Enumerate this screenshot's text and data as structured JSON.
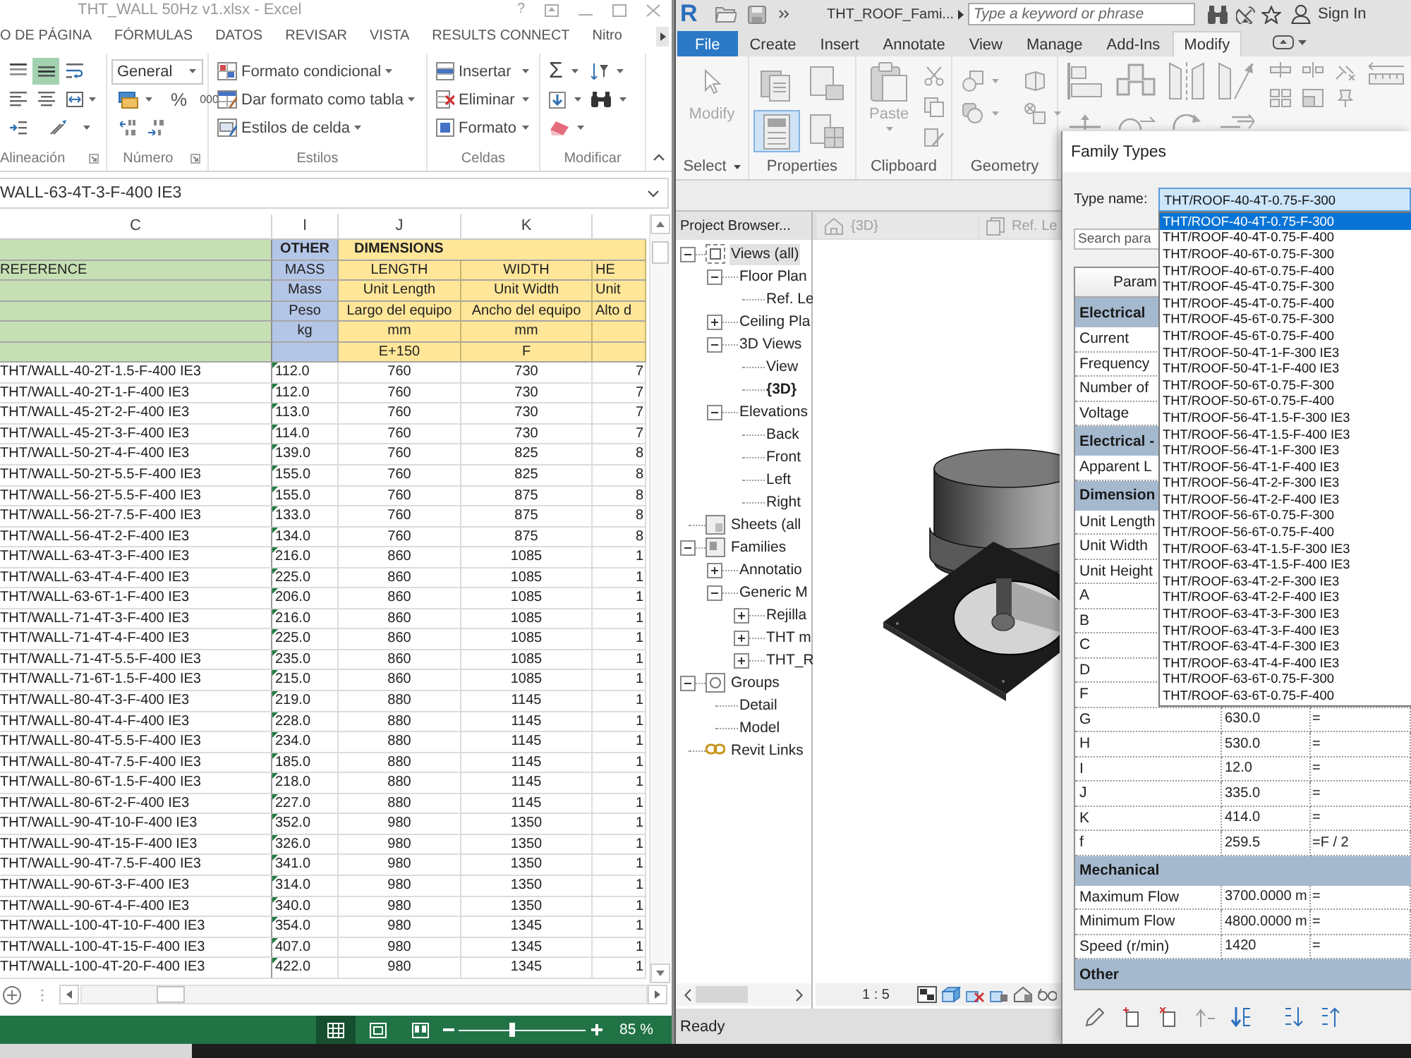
{
  "excel": {
    "title": "THT_WALL 50Hz v1.xlsx - Excel",
    "help": "?",
    "tabs": [
      {
        "label": "O DE PÁGINA",
        "selected": false
      },
      {
        "label": "FÓRMULAS",
        "selected": false
      },
      {
        "label": "DATOS",
        "selected": false
      },
      {
        "label": "REVISAR",
        "selected": false
      },
      {
        "label": "VISTA",
        "selected": false
      },
      {
        "label": "RESULTS CONNECT",
        "selected": false
      },
      {
        "label": "Nitro",
        "selected": false
      }
    ],
    "ribbon": {
      "alignment": {
        "label": "Alineación",
        "buttons": [
          {
            "selected": false
          },
          {
            "selected": true
          },
          {
            "selected": false
          },
          {
            "selected": false
          },
          {
            "selected": false
          },
          {
            "selected": false
          },
          {
            "selected": false
          },
          {
            "selected": false
          }
        ]
      },
      "number": {
        "label": "Número",
        "format": "General",
        "symbols": [
          "%",
          "000"
        ]
      },
      "styles": {
        "label": "Estilos",
        "commands": [
          "Formato condicional",
          "Dar formato como tabla",
          "Estilos de celda"
        ]
      },
      "cells": {
        "label": "Celdas",
        "commands": [
          "Insertar",
          "Eliminar",
          "Formato"
        ]
      },
      "editing": {
        "label": "Modificar",
        "autosum": "Σ"
      }
    },
    "formula_bar": {
      "value": "WALL-63-4T-3-F-400 IE3"
    },
    "sheet": {
      "columns": [
        "C",
        "I",
        "J",
        "K"
      ],
      "header_rows": [
        {
          "I": "OTHER",
          "J": "DIMENSIONS"
        },
        {
          "C": "REFERENCE",
          "I": "MASS",
          "J": "LENGTH",
          "K": "WIDTH",
          "column_5": "HE"
        },
        {
          "I": "Mass",
          "J": "Unit Length",
          "K": "Unit Width",
          "column_5": "Unit"
        },
        {
          "I": "Peso",
          "J": "Largo del equipo",
          "K": "Ancho del equipo",
          "column_5": "Alto d"
        },
        {
          "I": "kg",
          "J": "mm",
          "K": "mm"
        },
        {
          "J": "E+150",
          "K": "F"
        }
      ],
      "rows": [
        {
          "C": "THT/WALL-40-2T-1.5-F-400 IE3",
          "I": "112.0",
          "J": "760",
          "K": "730",
          "column_5": "7",
          "flag": true
        },
        {
          "C": "THT/WALL-40-2T-1-F-400 IE3",
          "I": "112.0",
          "J": "760",
          "K": "730",
          "column_5": "7",
          "flag": true
        },
        {
          "C": "THT/WALL-45-2T-2-F-400 IE3",
          "I": "113.0",
          "J": "760",
          "K": "730",
          "column_5": "7",
          "flag": true
        },
        {
          "C": "THT/WALL-45-2T-3-F-400 IE3",
          "I": "114.0",
          "J": "760",
          "K": "730",
          "column_5": "7",
          "flag": true
        },
        {
          "C": "THT/WALL-50-2T-4-F-400 IE3",
          "I": "139.0",
          "J": "760",
          "K": "825",
          "column_5": "8",
          "flag": true
        },
        {
          "C": "THT/WALL-50-2T-5.5-F-400 IE3",
          "I": "155.0",
          "J": "760",
          "K": "825",
          "column_5": "8",
          "flag": true
        },
        {
          "C": "THT/WALL-56-2T-5.5-F-400 IE3",
          "I": "155.0",
          "J": "760",
          "K": "875",
          "column_5": "8",
          "flag": true
        },
        {
          "C": "THT/WALL-56-2T-7.5-F-400 IE3",
          "I": "133.0",
          "J": "760",
          "K": "875",
          "column_5": "8",
          "flag": true
        },
        {
          "C": "THT/WALL-56-4T-2-F-400 IE3",
          "I": "134.0",
          "J": "760",
          "K": "875",
          "column_5": "8",
          "flag": true
        },
        {
          "C": "THT/WALL-63-4T-3-F-400 IE3",
          "I": "216.0",
          "J": "860",
          "K": "1085",
          "column_5": "1",
          "flag": true
        },
        {
          "C": "THT/WALL-63-4T-4-F-400 IE3",
          "I": "225.0",
          "J": "860",
          "K": "1085",
          "column_5": "1",
          "flag": true
        },
        {
          "C": "THT/WALL-63-6T-1-F-400 IE3",
          "I": "206.0",
          "J": "860",
          "K": "1085",
          "column_5": "1",
          "flag": true
        },
        {
          "C": "THT/WALL-71-4T-3-F-400 IE3",
          "I": "216.0",
          "J": "860",
          "K": "1085",
          "column_5": "1",
          "flag": true
        },
        {
          "C": "THT/WALL-71-4T-4-F-400 IE3",
          "I": "225.0",
          "J": "860",
          "K": "1085",
          "column_5": "1",
          "flag": true
        },
        {
          "C": "THT/WALL-71-4T-5.5-F-400 IE3",
          "I": "235.0",
          "J": "860",
          "K": "1085",
          "column_5": "1",
          "flag": true
        },
        {
          "C": "THT/WALL-71-6T-1.5-F-400 IE3",
          "I": "215.0",
          "J": "860",
          "K": "1085",
          "column_5": "1",
          "flag": true
        },
        {
          "C": "THT/WALL-80-4T-3-F-400 IE3",
          "I": "219.0",
          "J": "880",
          "K": "1145",
          "column_5": "1",
          "flag": true
        },
        {
          "C": "THT/WALL-80-4T-4-F-400 IE3",
          "I": "228.0",
          "J": "880",
          "K": "1145",
          "column_5": "1",
          "flag": true
        },
        {
          "C": "THT/WALL-80-4T-5.5-F-400 IE3",
          "I": "234.0",
          "J": "880",
          "K": "1145",
          "column_5": "1",
          "flag": true
        },
        {
          "C": "THT/WALL-80-4T-7.5-F-400 IE3",
          "I": "185.0",
          "J": "880",
          "K": "1145",
          "column_5": "1",
          "flag": true
        },
        {
          "C": "THT/WALL-80-6T-1.5-F-400 IE3",
          "I": "218.0",
          "J": "880",
          "K": "1145",
          "column_5": "1",
          "flag": true
        },
        {
          "C": "THT/WALL-80-6T-2-F-400 IE3",
          "I": "227.0",
          "J": "880",
          "K": "1145",
          "column_5": "1",
          "flag": true
        },
        {
          "C": "THT/WALL-90-4T-10-F-400 IE3",
          "I": "352.0",
          "J": "980",
          "K": "1350",
          "column_5": "1",
          "flag": true
        },
        {
          "C": "THT/WALL-90-4T-15-F-400 IE3",
          "I": "326.0",
          "J": "980",
          "K": "1350",
          "column_5": "1",
          "flag": true
        },
        {
          "C": "THT/WALL-90-4T-7.5-F-400 IE3",
          "I": "341.0",
          "J": "980",
          "K": "1350",
          "column_5": "1",
          "flag": true
        },
        {
          "C": "THT/WALL-90-6T-3-F-400 IE3",
          "I": "314.0",
          "J": "980",
          "K": "1350",
          "column_5": "1",
          "flag": true
        },
        {
          "C": "THT/WALL-90-6T-4-F-400 IE3",
          "I": "340.0",
          "J": "980",
          "K": "1350",
          "column_5": "1",
          "flag": true
        },
        {
          "C": "THT/WALL-100-4T-10-F-400 IE3",
          "I": "354.0",
          "J": "980",
          "K": "1345",
          "column_5": "1",
          "flag": true
        },
        {
          "C": "THT/WALL-100-4T-15-F-400 IE3",
          "I": "407.0",
          "J": "980",
          "K": "1345",
          "column_5": "1",
          "flag": true
        },
        {
          "C": "THT/WALL-100-4T-20-F-400 IE3",
          "I": "422.0",
          "J": "980",
          "K": "1345",
          "column_5": "1",
          "flag": true
        }
      ]
    },
    "status_bar": {
      "views": [
        {
          "selected": true
        },
        {
          "selected": false
        },
        {
          "selected": false
        }
      ],
      "zoom": {
        "label": "85 %",
        "level": 0.42
      }
    }
  },
  "revit": {
    "logo": "R",
    "title": "THT_ROOF_Fami...",
    "search": {
      "placeholder": "Type a keyword or phrase"
    },
    "sign_in": "Sign In",
    "tabs": [
      {
        "label": "File",
        "kind": "application",
        "selected": false
      },
      {
        "label": "Create",
        "kind": "tab",
        "selected": false
      },
      {
        "label": "Insert",
        "kind": "tab",
        "selected": false
      },
      {
        "label": "Annotate",
        "kind": "tab",
        "selected": false
      },
      {
        "label": "View",
        "kind": "tab",
        "selected": false
      },
      {
        "label": "Manage",
        "kind": "tab",
        "selected": false
      },
      {
        "label": "Add-Ins",
        "kind": "tab",
        "selected": false
      },
      {
        "label": "Modify",
        "kind": "tab",
        "selected": true
      }
    ],
    "panels": [
      {
        "label": "Select",
        "command": "Modify"
      },
      {
        "label": "Properties",
        "buttons": [
          {
            "selected": false
          },
          {
            "selected": false
          },
          {
            "selected": true
          },
          {
            "selected": false
          }
        ]
      },
      {
        "label": "Clipboard",
        "command": "Paste"
      },
      {
        "label": "Geometry"
      }
    ],
    "project_browser": {
      "title": "Project Browser...",
      "tree": [
        {
          "label": "Views (all)",
          "expanded": true,
          "selected": true,
          "current": false,
          "children": [
            {
              "label": "Floor Plan",
              "expanded": true,
              "selected": false,
              "current": false,
              "children": [
                {
                  "label": "Ref. Le",
                  "selected": false,
                  "current": false
                }
              ]
            },
            {
              "label": "Ceiling Pla",
              "expanded": false,
              "selected": false,
              "current": false
            },
            {
              "label": "3D Views",
              "expanded": true,
              "selected": false,
              "current": false,
              "children": [
                {
                  "label": "View",
                  "selected": false,
                  "current": false
                },
                {
                  "label": "{3D}",
                  "selected": false,
                  "current": true
                }
              ]
            },
            {
              "label": "Elevations",
              "expanded": true,
              "selected": false,
              "current": false,
              "children": [
                {
                  "label": "Back",
                  "selected": false,
                  "current": false
                },
                {
                  "label": "Front",
                  "selected": false,
                  "current": false
                },
                {
                  "label": "Left",
                  "selected": false,
                  "current": false
                },
                {
                  "label": "Right",
                  "selected": false,
                  "current": false
                }
              ]
            }
          ]
        },
        {
          "label": "Sheets (all",
          "selected": false,
          "current": false
        },
        {
          "label": "Families",
          "expanded": true,
          "selected": false,
          "current": false,
          "children": [
            {
              "label": "Annotatio",
              "expanded": false,
              "selected": false,
              "current": false
            },
            {
              "label": "Generic M",
              "expanded": true,
              "selected": false,
              "current": false,
              "children": [
                {
                  "label": "Rejilla",
                  "expanded": false,
                  "selected": false,
                  "current": false
                },
                {
                  "label": "THT m",
                  "expanded": false,
                  "selected": false,
                  "current": false
                },
                {
                  "label": "THT_R",
                  "expanded": false,
                  "selected": false,
                  "current": false
                }
              ]
            }
          ]
        },
        {
          "label": "Groups",
          "expanded": true,
          "selected": false,
          "current": false,
          "children": [
            {
              "label": "Detail",
              "selected": false,
              "current": false
            },
            {
              "label": "Model",
              "selected": false,
              "current": false
            }
          ]
        },
        {
          "label": "Revit Links",
          "selected": false,
          "current": false
        }
      ]
    },
    "view_tabs": [
      {
        "label": "{3D}"
      },
      {
        "label": "Ref. Le"
      }
    ],
    "view_scale": "1 : 5",
    "status": "Ready",
    "family_types": {
      "title": "Family Types",
      "type_name_label": "Type name:",
      "type_name": "THT/ROOF-40-4T-0.75-F-300",
      "options": [
        {
          "label": "THT/ROOF-40-4T-0.75-F-300",
          "selected": true
        },
        {
          "label": "THT/ROOF-40-4T-0.75-F-400",
          "selected": false
        },
        {
          "label": "THT/ROOF-40-6T-0.75-F-300",
          "selected": false
        },
        {
          "label": "THT/ROOF-40-6T-0.75-F-400",
          "selected": false
        },
        {
          "label": "THT/ROOF-45-4T-0.75-F-300",
          "selected": false
        },
        {
          "label": "THT/ROOF-45-4T-0.75-F-400",
          "selected": false
        },
        {
          "label": "THT/ROOF-45-6T-0.75-F-300",
          "selected": false
        },
        {
          "label": "THT/ROOF-45-6T-0.75-F-400",
          "selected": false
        },
        {
          "label": "THT/ROOF-50-4T-1-F-300 IE3",
          "selected": false
        },
        {
          "label": "THT/ROOF-50-4T-1-F-400 IE3",
          "selected": false
        },
        {
          "label": "THT/ROOF-50-6T-0.75-F-300",
          "selected": false
        },
        {
          "label": "THT/ROOF-50-6T-0.75-F-400",
          "selected": false
        },
        {
          "label": "THT/ROOF-56-4T-1.5-F-300 IE3",
          "selected": false
        },
        {
          "label": "THT/ROOF-56-4T-1.5-F-400 IE3",
          "selected": false
        },
        {
          "label": "THT/ROOF-56-4T-1-F-300 IE3",
          "selected": false
        },
        {
          "label": "THT/ROOF-56-4T-1-F-400 IE3",
          "selected": false
        },
        {
          "label": "THT/ROOF-56-4T-2-F-300 IE3",
          "selected": false
        },
        {
          "label": "THT/ROOF-56-4T-2-F-400 IE3",
          "selected": false
        },
        {
          "label": "THT/ROOF-56-6T-0.75-F-300",
          "selected": false
        },
        {
          "label": "THT/ROOF-56-6T-0.75-F-400",
          "selected": false
        },
        {
          "label": "THT/ROOF-63-4T-1.5-F-300 IE3",
          "selected": false
        },
        {
          "label": "THT/ROOF-63-4T-1.5-F-400 IE3",
          "selected": false
        },
        {
          "label": "THT/ROOF-63-4T-2-F-300 IE3",
          "selected": false
        },
        {
          "label": "THT/ROOF-63-4T-2-F-400 IE3",
          "selected": false
        },
        {
          "label": "THT/ROOF-63-4T-3-F-300 IE3",
          "selected": false
        },
        {
          "label": "THT/ROOF-63-4T-3-F-400 IE3",
          "selected": false
        },
        {
          "label": "THT/ROOF-63-4T-4-F-300 IE3",
          "selected": false
        },
        {
          "label": "THT/ROOF-63-4T-4-F-400 IE3",
          "selected": false
        },
        {
          "label": "THT/ROOF-63-6T-0.75-F-300",
          "selected": false
        },
        {
          "label": "THT/ROOF-63-6T-0.75-F-400",
          "selected": false
        }
      ],
      "search": {
        "placeholder": "Search para"
      },
      "column_header": "Param",
      "groups": [
        {
          "name": "Electrical",
          "rows": [
            {
              "name": "Current"
            },
            {
              "name": "Frequency"
            },
            {
              "name": "Number of"
            },
            {
              "name": "Voltage"
            }
          ]
        },
        {
          "name": "Electrical -",
          "rows": [
            {
              "name": "Apparent L"
            }
          ]
        },
        {
          "name": "Dimension",
          "rows": [
            {
              "name": "Unit Length"
            },
            {
              "name": "Unit Width"
            },
            {
              "name": "Unit Height"
            },
            {
              "name": "A"
            },
            {
              "name": "B"
            },
            {
              "name": "C"
            },
            {
              "name": "D"
            },
            {
              "name": "F"
            },
            {
              "name": "G",
              "value": "630.0",
              "formula": "="
            },
            {
              "name": "H",
              "value": "530.0",
              "formula": "="
            },
            {
              "name": "I",
              "value": "12.0",
              "formula": "="
            },
            {
              "name": "J",
              "value": "335.0",
              "formula": "="
            },
            {
              "name": "K",
              "value": "414.0",
              "formula": "="
            },
            {
              "name": "f",
              "value": "259.5",
              "formula": "=F / 2"
            }
          ]
        },
        {
          "name": "Mechanical",
          "rows": [
            {
              "name": "Maximum Flow",
              "value": "3700.0000 m",
              "formula": "="
            },
            {
              "name": "Minimum Flow",
              "value": "4800.0000 m",
              "formula": "="
            },
            {
              "name": "Speed (r/min)",
              "value": "1420",
              "formula": "="
            }
          ]
        },
        {
          "name": "Other"
        }
      ]
    }
  }
}
